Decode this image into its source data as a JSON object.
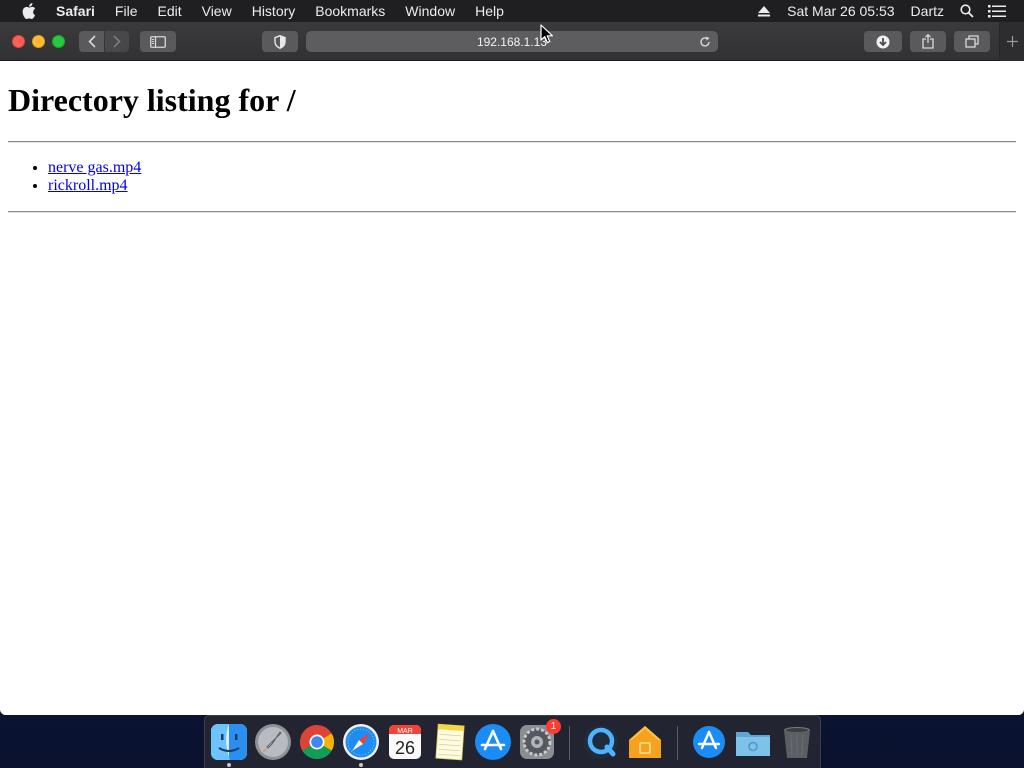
{
  "menubar": {
    "app_name": "Safari",
    "items": [
      "File",
      "Edit",
      "View",
      "History",
      "Bookmarks",
      "Window",
      "Help"
    ],
    "date_time": "Sat Mar 26  05:53",
    "user": "Dartz"
  },
  "toolbar": {
    "address": "192.168.1.13"
  },
  "page": {
    "heading": "Directory listing for /",
    "files": [
      "nerve gas.mp4",
      "rickroll.mp4"
    ]
  },
  "dock": {
    "calendar_month": "MAR",
    "calendar_day": "26",
    "settings_badge": "1"
  },
  "colors": {
    "link": "#0000ee",
    "close": "#fe5f57",
    "minimize": "#febc2e",
    "maximize": "#28c840"
  },
  "icons": [
    "apple-icon",
    "eject-icon",
    "spotlight-search-icon",
    "notification-center-icon",
    "back-icon",
    "forward-icon",
    "sidebar-icon",
    "shield-icon",
    "reload-icon",
    "download-icon",
    "share-icon",
    "tabs-icon",
    "plus-icon",
    "finder-icon",
    "launchpad-icon",
    "chrome-icon",
    "safari-icon",
    "calendar-icon",
    "notes-icon",
    "app-store-icon",
    "system-preferences-icon",
    "quicktime-icon",
    "home-icon",
    "downloads-folder-icon",
    "folder-icon",
    "trash-icon"
  ]
}
